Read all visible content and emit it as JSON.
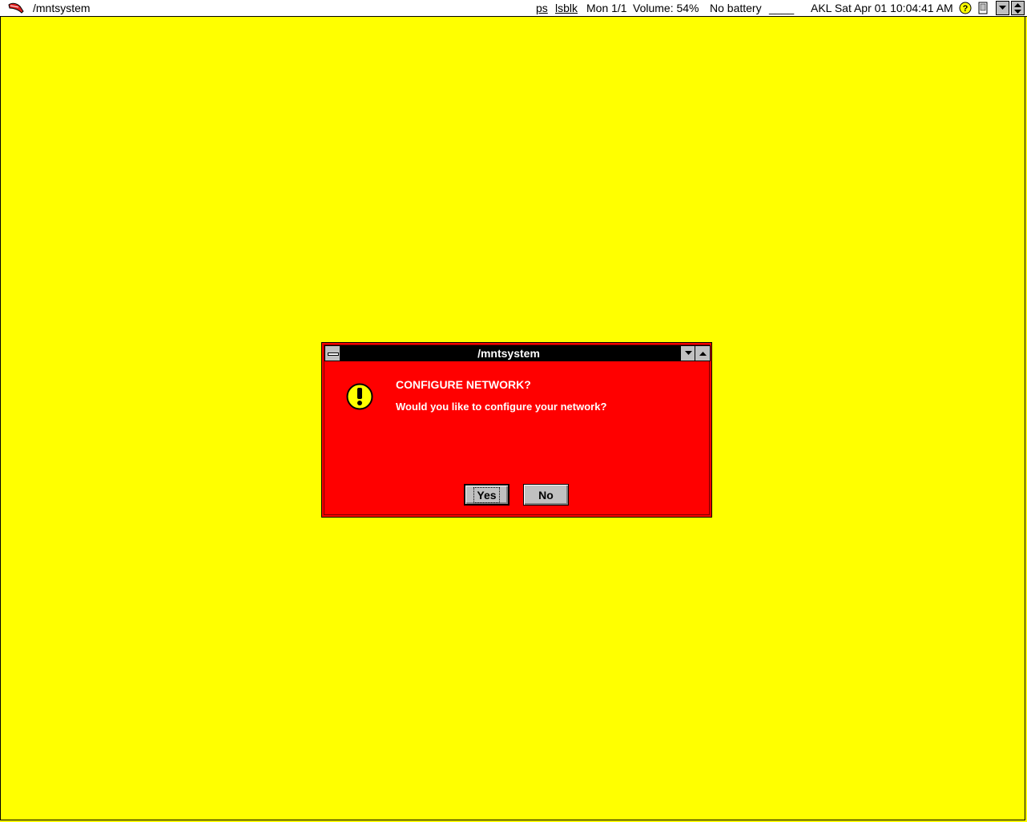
{
  "topbar": {
    "app_title": "/mntsystem",
    "items": {
      "ps": "ps",
      "lsblk": "lsblk",
      "monitor": "Mon 1/1",
      "volume": "Volume: 54%",
      "battery": "No battery",
      "blank": "____",
      "clock": "AKL Sat Apr 01 10:04:41 AM"
    },
    "icons": [
      "logo-icon",
      "help-icon",
      "clipboard-icon",
      "minimize-arrow-icon",
      "resize-arrow-icon"
    ]
  },
  "dialog": {
    "title": "/mntsystem",
    "heading": "CONFIGURE NETWORK?",
    "message": "Would you like to configure your network?",
    "buttons": {
      "yes": "Yes",
      "no": "No"
    },
    "icon": "warning-icon"
  },
  "colors": {
    "desktop": "#ffff00",
    "dialog_bg": "#ff0000",
    "titlebar": "#000000",
    "button": "#c0c0c0"
  }
}
